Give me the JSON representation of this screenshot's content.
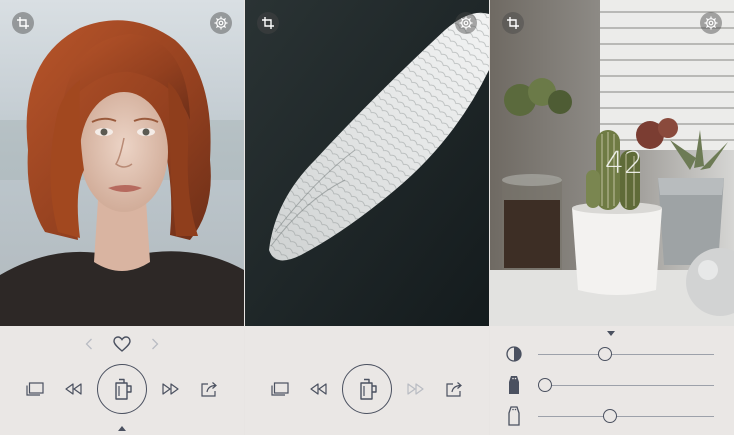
{
  "screen3": {
    "shots_remaining": "42"
  },
  "colors": {
    "icon": "#4b5160",
    "icon_disabled": "#b9bcc3",
    "panel_bg": "#eae7e5"
  },
  "adjustments": [
    {
      "name": "contrast",
      "icon": "contrast-icon",
      "level": 0.37
    },
    {
      "name": "grain",
      "icon": "salt-shaker-icon",
      "level": 0.0
    },
    {
      "name": "fade",
      "icon": "shaker-icon",
      "level": 0.4
    }
  ]
}
